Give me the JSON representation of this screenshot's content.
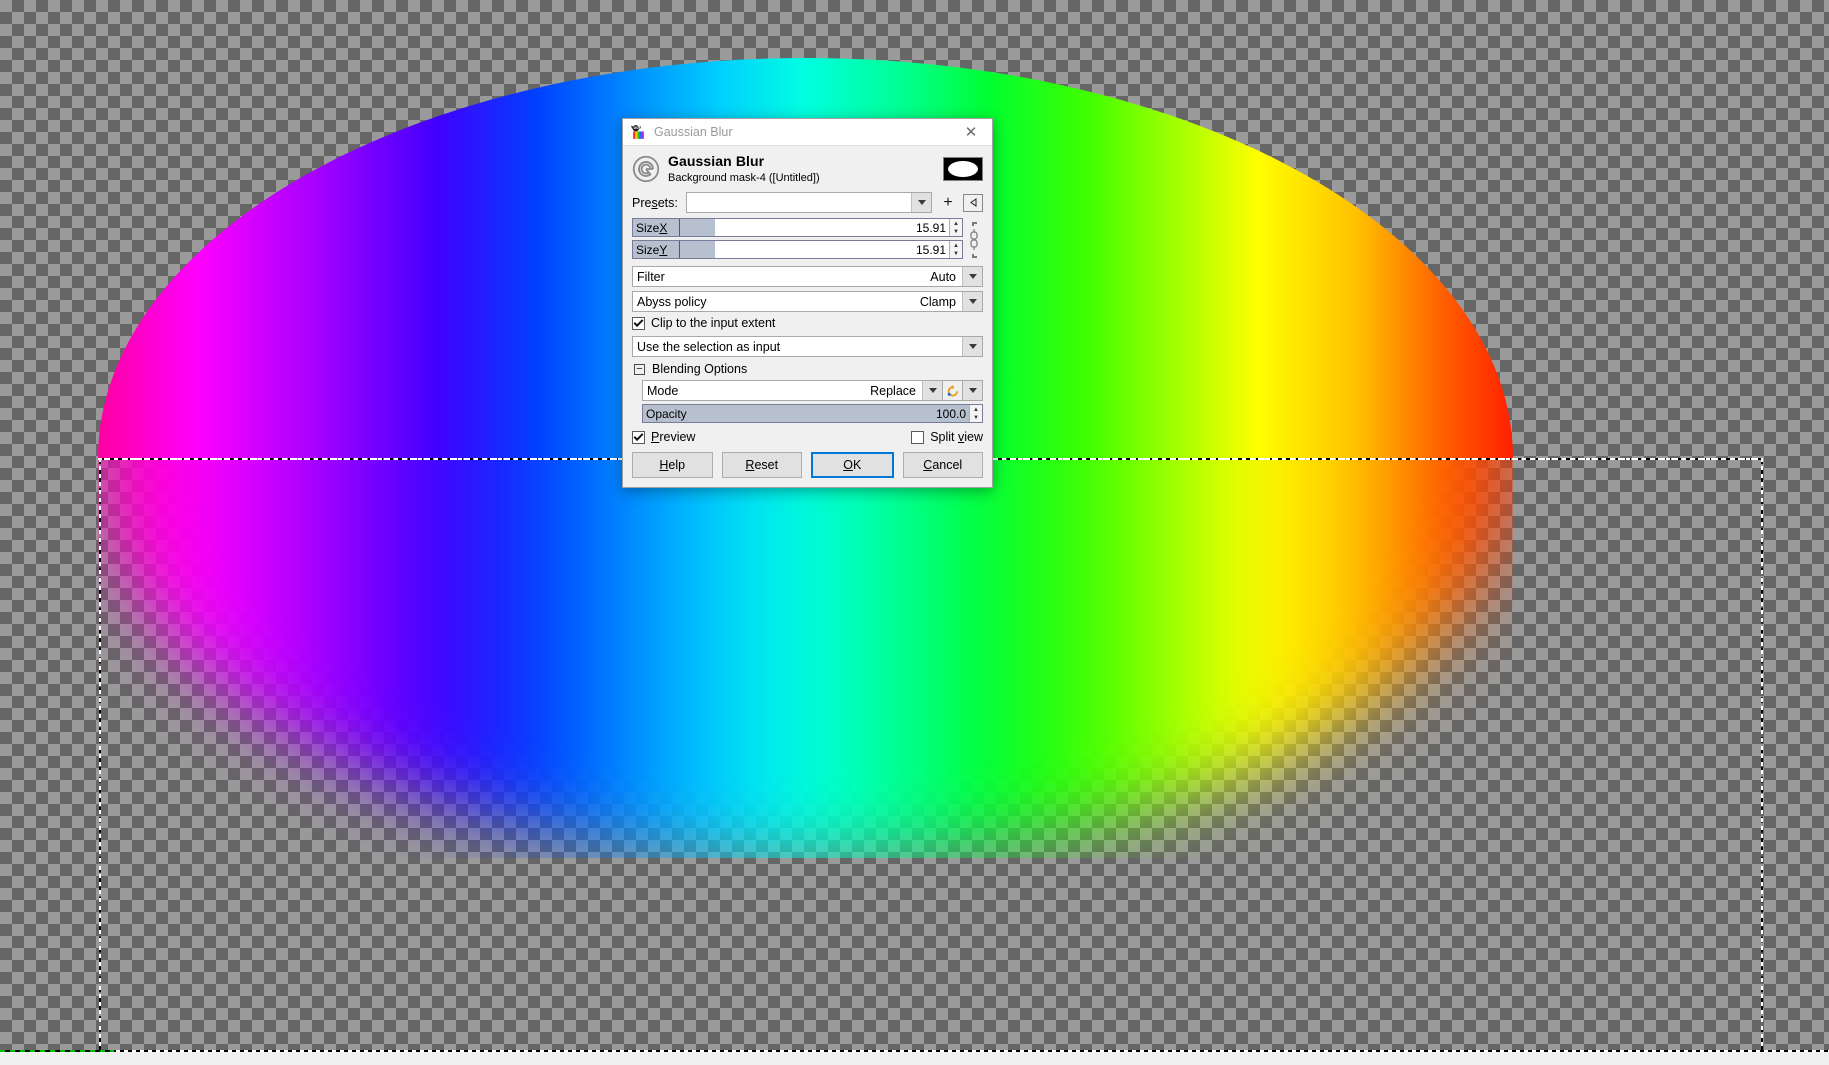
{
  "canvas": {
    "name": "gimp-image-canvas",
    "selection_description": "Elliptical selection with hue gradient, bottom half gaussian-blurred",
    "transparency_checker": true
  },
  "dialog": {
    "titlebar": {
      "icon": "gimp-wilber-icon",
      "title": "Gaussian Blur",
      "close_label": "✕"
    },
    "header": {
      "icon": "gaussian-blur-filter-icon",
      "title": "Gaussian Blur",
      "subtitle": "Background mask-4 ([Untitled])",
      "thumbnail": "selection-mask-thumbnail"
    },
    "presets": {
      "label": "Presets:",
      "value": "",
      "placeholder": "",
      "add_label": "+",
      "menu_label": "◁"
    },
    "size_x": {
      "label": "Size X",
      "value": "15.91",
      "fill_percent": 13
    },
    "size_y": {
      "label": "Size Y",
      "value": "15.91",
      "fill_percent": 13
    },
    "chain": {
      "name": "chain-link-icon",
      "linked": true
    },
    "filter": {
      "label": "Filter",
      "value": "Auto"
    },
    "abyss_policy": {
      "label": "Abyss policy",
      "value": "Clamp"
    },
    "clip_to_input": {
      "label": "Clip to the input extent",
      "checked": true
    },
    "input_source": {
      "value": "Use the selection as input"
    },
    "blending_options": {
      "label": "Blending Options",
      "expanded": true,
      "collapse_glyph": "−"
    },
    "mode": {
      "label": "Mode",
      "value": "Replace",
      "reset_icon": "reset-arrow-icon"
    },
    "opacity": {
      "label": "Opacity",
      "value": "100.0",
      "fill_percent": 100
    },
    "preview": {
      "label": "Preview",
      "checked": true
    },
    "split_view": {
      "label": "Split view",
      "checked": false
    },
    "buttons": {
      "help": "Help",
      "reset": "Reset",
      "ok": "OK",
      "cancel": "Cancel",
      "focused": "ok"
    }
  },
  "colors": {
    "accent_focus": "#0078d7",
    "slider_fill": "#b6c0cf",
    "dialog_bg": "#f0f0f0",
    "titlebar_bg": "#ffffff",
    "checker_light": "#9a9a9a",
    "checker_dark": "#666666"
  }
}
